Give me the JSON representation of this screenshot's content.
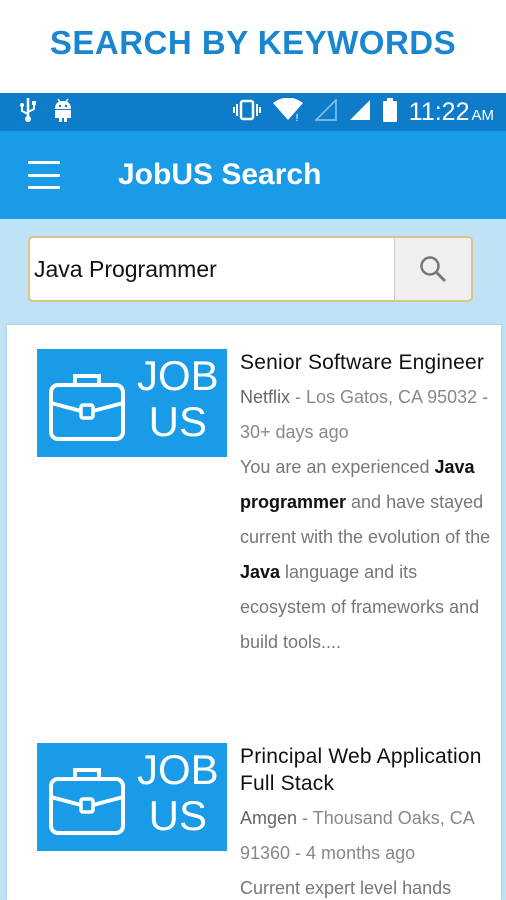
{
  "banner": {
    "title": "SEARCH BY KEYWORDS"
  },
  "status": {
    "time": "11:22",
    "ampm": "AM"
  },
  "appbar": {
    "title": "JobUS Search"
  },
  "search": {
    "value": "Java Programmer",
    "placeholder": ""
  },
  "logo": {
    "line1": "JOB",
    "line2": "US"
  },
  "jobs": [
    {
      "title": "Senior Software Engineer",
      "company": "Netflix",
      "location": " - Los Gatos, CA 95032 - 30+ days ago",
      "desc_1": "You are an experienced ",
      "desc_bold_1": "Java programmer",
      "desc_2": " and have stayed current with the evolution of the ",
      "desc_bold_2": "Java",
      "desc_3": " language and its ecosystem of frameworks and build tools...."
    },
    {
      "title": "Principal Web Application Full Stack",
      "company": "Amgen",
      "location": " - Thousand Oaks, CA 91360 - 4 months ago",
      "desc_1": "Current expert level hands"
    }
  ],
  "colors": {
    "primary": "#1a9be8",
    "statusbar": "#0f7cc9",
    "banner_text": "#1a86d0",
    "search_bg": "#bfe2f6"
  }
}
